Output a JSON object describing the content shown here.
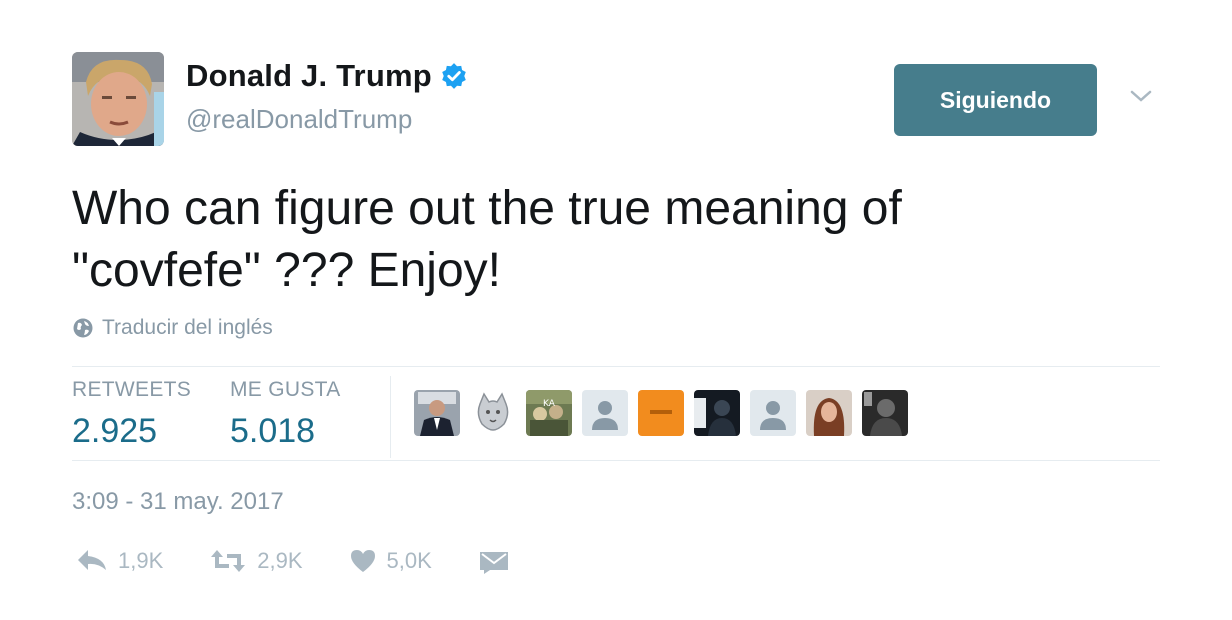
{
  "user": {
    "display_name": "Donald J. Trump",
    "handle": "@realDonaldTrump",
    "verified_icon": "verified-badge-icon"
  },
  "follow_button": {
    "label": "Siguiendo",
    "color": "#467d8c"
  },
  "tweet": {
    "text": "Who can figure out the true meaning of\n\"covfefe\" ???  Enjoy!",
    "translate_label": "Traducir del inglés",
    "timestamp": "3:09 - 31 may. 2017"
  },
  "stats": {
    "retweets_label": "RETWEETS",
    "retweets_value": "2.925",
    "likes_label": "ME GUSTA",
    "likes_value": "5.018",
    "value_color": "#1b6c8a"
  },
  "likers": [
    {
      "icon": "liker-avatar-suit"
    },
    {
      "icon": "liker-avatar-cat"
    },
    {
      "icon": "liker-avatar-photo"
    },
    {
      "icon": "liker-avatar-default"
    },
    {
      "icon": "liker-avatar-orange"
    },
    {
      "icon": "liker-avatar-dark"
    },
    {
      "icon": "liker-avatar-default"
    },
    {
      "icon": "liker-avatar-woman"
    },
    {
      "icon": "liker-avatar-dark-portrait"
    }
  ],
  "actions": {
    "reply_count": "1,9K",
    "retweet_count": "2,9K",
    "like_count": "5,0K"
  }
}
